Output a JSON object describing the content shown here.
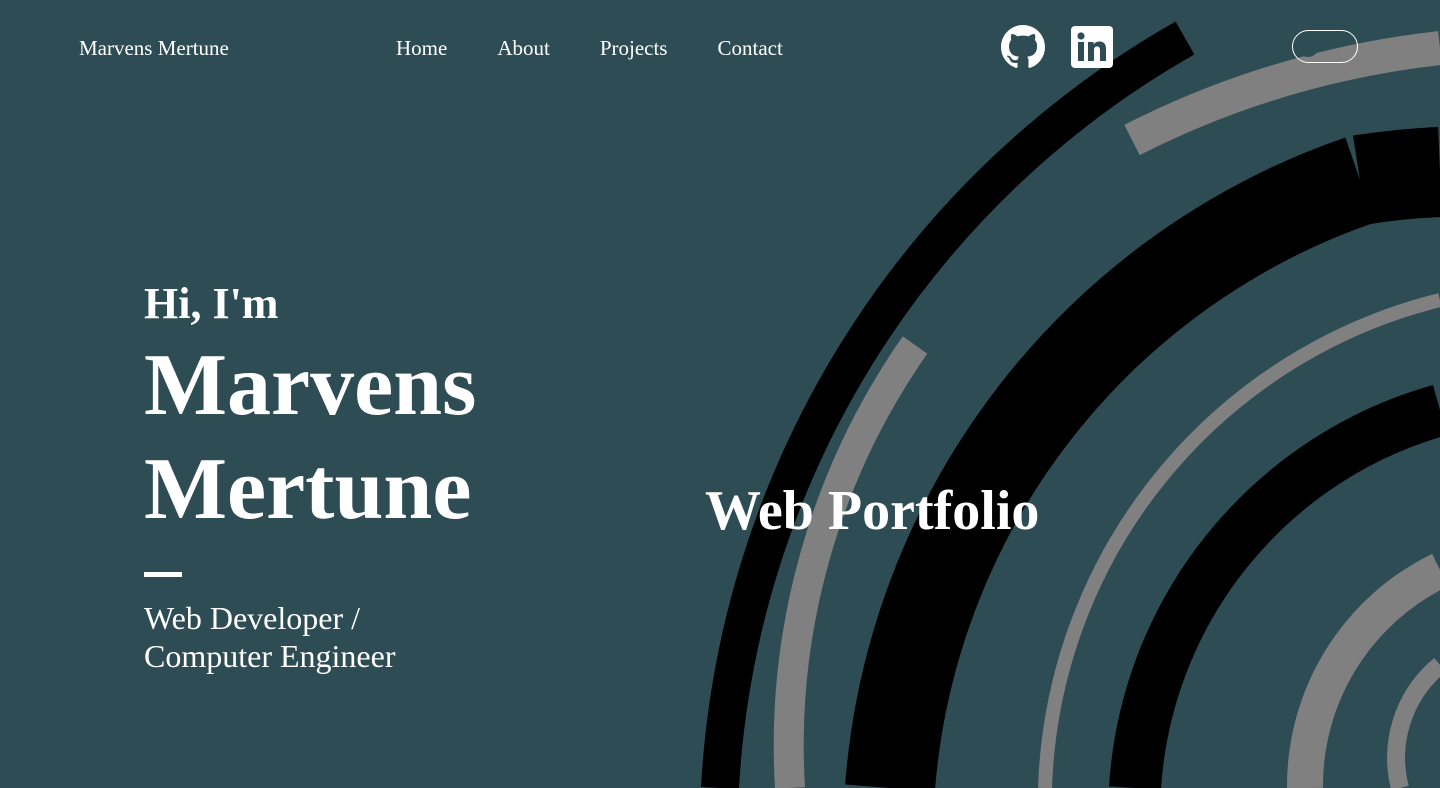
{
  "navbar": {
    "brand": "Marvens Mertune",
    "links": [
      {
        "label": "Home"
      },
      {
        "label": "About"
      },
      {
        "label": "Projects"
      },
      {
        "label": "Contact"
      }
    ],
    "social": [
      {
        "icon": "github-icon"
      },
      {
        "icon": "linkedin-icon"
      }
    ],
    "theme_toggle": {
      "icon": "theme-toggle"
    }
  },
  "hero": {
    "greeting": "Hi, I'm",
    "name_line1": "Marvens",
    "name_line2": "Mertune",
    "role_line1": "Web Developer /",
    "role_line2": "Computer Engineer"
  },
  "portfolio": {
    "title": "Web Portfolio"
  },
  "colors": {
    "background": "#2e4c54",
    "text": "#ffffff",
    "arc_dark": "#000000",
    "arc_grey": "#808080"
  }
}
